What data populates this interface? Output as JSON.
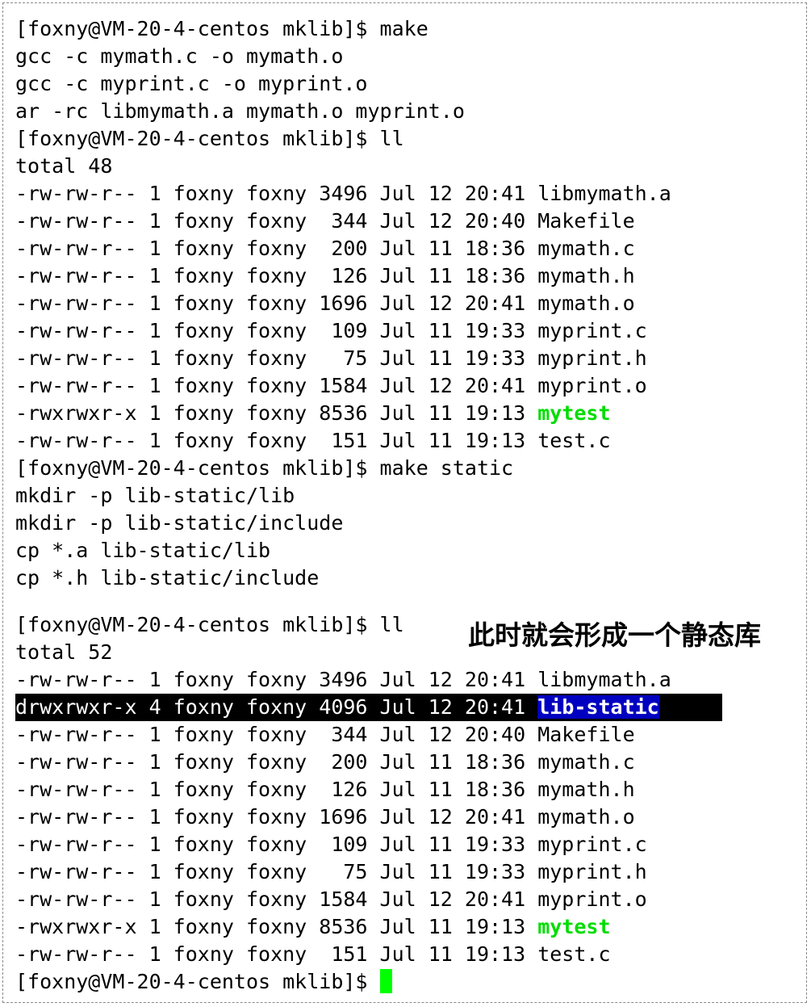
{
  "colors": {
    "background": "#ffffff",
    "text": "#000000",
    "executable": "#00dd00",
    "directory_bg": "#0000c0",
    "highlight_row_bg": "#000000",
    "cursor": "#00ff00"
  },
  "annotation": "此时就会形成一个静态库",
  "block1": {
    "prompt_make": "[foxny@VM-20-4-centos mklib]$ make",
    "out1": "gcc -c mymath.c -o mymath.o",
    "out2": "gcc -c myprint.c -o myprint.o",
    "out3": "ar -rc libmymath.a mymath.o myprint.o",
    "prompt_ll": "[foxny@VM-20-4-centos mklib]$ ll",
    "total": "total 48",
    "files": [
      "-rw-rw-r-- 1 foxny foxny 3496 Jul 12 20:41 libmymath.a",
      "-rw-rw-r-- 1 foxny foxny  344 Jul 12 20:40 Makefile",
      "-rw-rw-r-- 1 foxny foxny  200 Jul 11 18:36 mymath.c",
      "-rw-rw-r-- 1 foxny foxny  126 Jul 11 18:36 mymath.h",
      "-rw-rw-r-- 1 foxny foxny 1696 Jul 12 20:41 mymath.o",
      "-rw-rw-r-- 1 foxny foxny  109 Jul 11 19:33 myprint.c",
      "-rw-rw-r-- 1 foxny foxny   75 Jul 11 19:33 myprint.h",
      "-rw-rw-r-- 1 foxny foxny 1584 Jul 12 20:41 myprint.o"
    ],
    "exec_prefix": "-rwxrwxr-x 1 foxny foxny 8536 Jul 11 19:13 ",
    "exec_name": "mytest",
    "last_file": "-rw-rw-r-- 1 foxny foxny  151 Jul 11 19:13 test.c"
  },
  "block2": {
    "prompt_make_static": "[foxny@VM-20-4-centos mklib]$ make static",
    "out1": "mkdir -p lib-static/lib",
    "out2": "mkdir -p lib-static/include",
    "out3": "cp *.a lib-static/lib",
    "out4": "cp *.h lib-static/include"
  },
  "block3": {
    "prompt_ll": "[foxny@VM-20-4-centos mklib]$ ll",
    "total": "total 52",
    "first_file": "-rw-rw-r-- 1 foxny foxny 3496 Jul 12 20:41 libmymath.a",
    "dir_prefix": "drwxrwxr-x 4 foxny foxny 4096 Jul 12 20:41 ",
    "dir_name": "lib-static",
    "files": [
      "-rw-rw-r-- 1 foxny foxny  344 Jul 12 20:40 Makefile",
      "-rw-rw-r-- 1 foxny foxny  200 Jul 11 18:36 mymath.c",
      "-rw-rw-r-- 1 foxny foxny  126 Jul 11 18:36 mymath.h",
      "-rw-rw-r-- 1 foxny foxny 1696 Jul 12 20:41 mymath.o",
      "-rw-rw-r-- 1 foxny foxny  109 Jul 11 19:33 myprint.c",
      "-rw-rw-r-- 1 foxny foxny   75 Jul 11 19:33 myprint.h",
      "-rw-rw-r-- 1 foxny foxny 1584 Jul 12 20:41 myprint.o"
    ],
    "exec_prefix": "-rwxrwxr-x 1 foxny foxny 8536 Jul 11 19:13 ",
    "exec_name": "mytest",
    "last_file": "-rw-rw-r-- 1 foxny foxny  151 Jul 11 19:13 test.c",
    "final_prompt": "[foxny@VM-20-4-centos mklib]$ "
  }
}
